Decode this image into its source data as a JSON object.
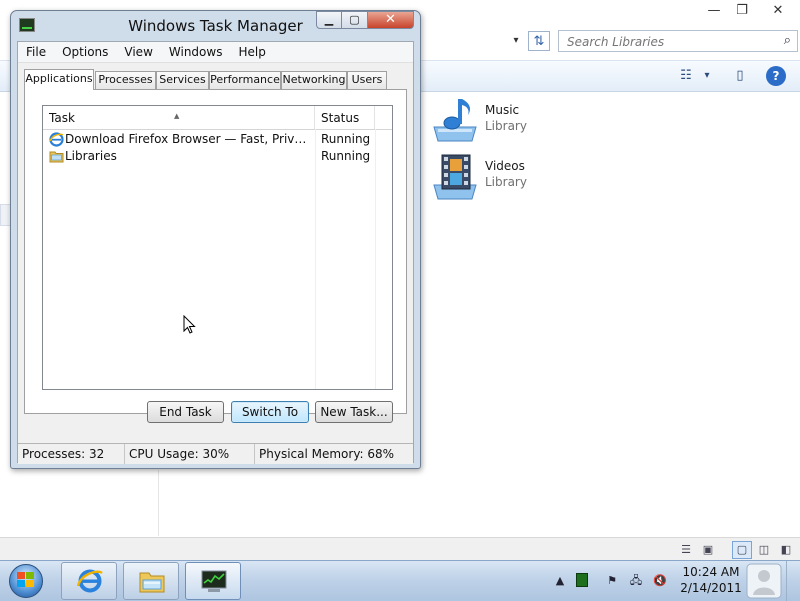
{
  "explorer": {
    "search_placeholder": "Search Libraries",
    "libraries": [
      {
        "name": "Music",
        "type": "Library"
      },
      {
        "name": "Videos",
        "type": "Library"
      }
    ],
    "caption": {
      "minimize": "—",
      "maximize": "❐",
      "close": "✕"
    }
  },
  "taskmgr": {
    "title": "Windows Task Manager",
    "menu": [
      "File",
      "Options",
      "View",
      "Windows",
      "Help"
    ],
    "tabs": [
      "Applications",
      "Processes",
      "Services",
      "Performance",
      "Networking",
      "Users"
    ],
    "active_tab": "Applications",
    "columns": {
      "task": "Task",
      "status": "Status"
    },
    "rows": [
      {
        "task": "Download Firefox Browser — Fast, Private & Free — from Mozilla - Windows Internet Explorer",
        "status": "Running",
        "icon": "ie-icon"
      },
      {
        "task": "Libraries",
        "status": "Running",
        "icon": "folder-icon"
      }
    ],
    "buttons": {
      "end_task": "End Task",
      "switch_to": "Switch To",
      "new_task": "New Task..."
    },
    "status": {
      "processes": "Processes: 32",
      "cpu": "CPU Usage: 30%",
      "memory": "Physical Memory: 68%"
    }
  },
  "taskbar": {
    "pinned": [
      "internet-explorer",
      "windows-explorer",
      "task-manager"
    ],
    "clock_time": "10:24 AM",
    "clock_date": "2/14/2011"
  },
  "colors": {
    "close_button": "#c7432b",
    "taskbar": "#bfd2e8",
    "window_frame": "#cfdcea",
    "selected_button": "#bee6fd"
  }
}
